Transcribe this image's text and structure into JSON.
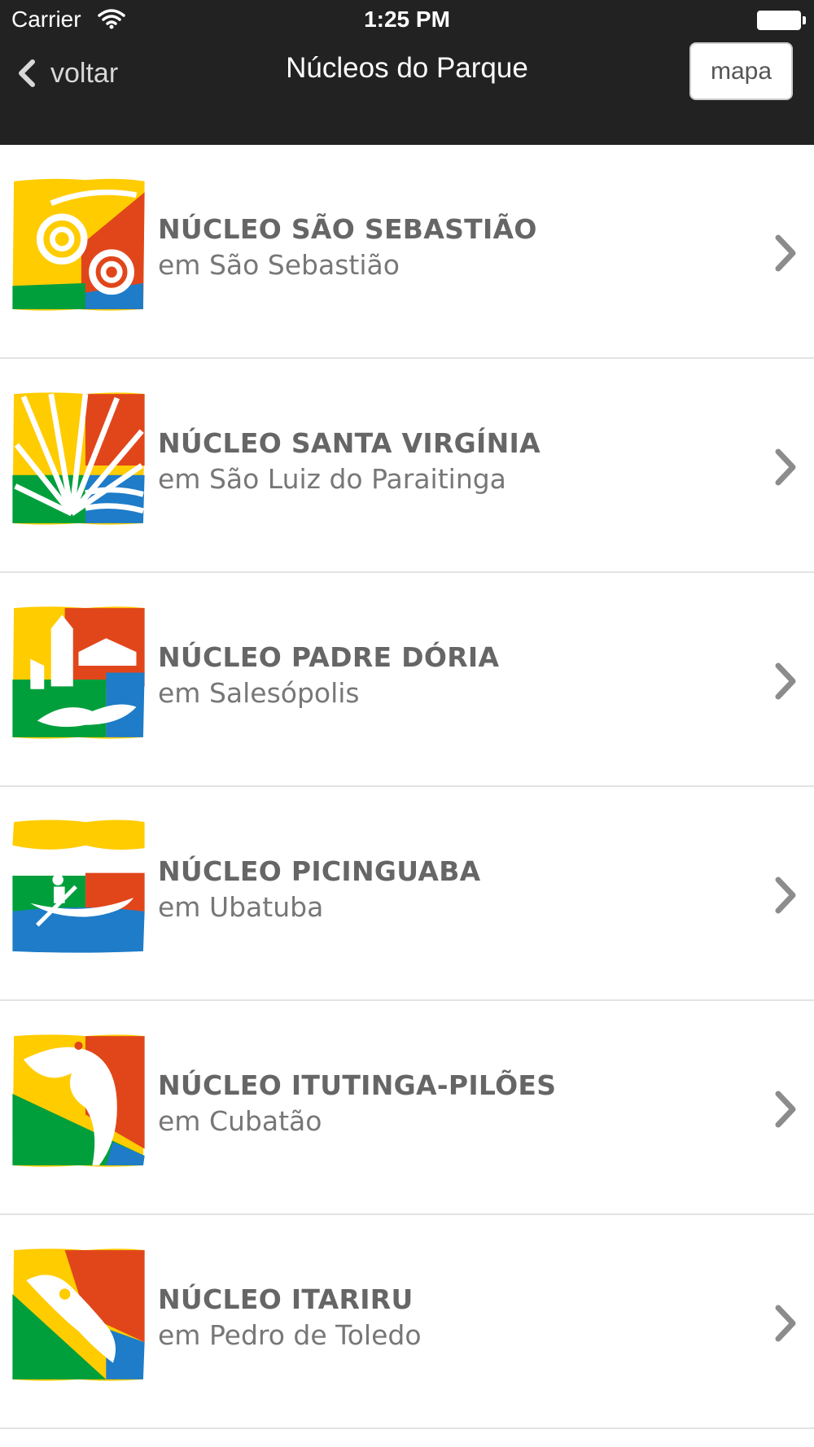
{
  "status_bar": {
    "carrier": "Carrier",
    "time": "1:25 PM"
  },
  "nav": {
    "back_label": "voltar",
    "title": "Núcleos do Parque",
    "map_button": "mapa"
  },
  "items": [
    {
      "name": "NÚCLEO SÃO SEBASTIÃO",
      "city": "em São Sebastião"
    },
    {
      "name": "NÚCLEO SANTA VIRGÍNIA",
      "city": "em São Luiz do Paraitinga"
    },
    {
      "name": "NÚCLEO PADRE DÓRIA",
      "city": "em Salesópolis"
    },
    {
      "name": "NÚCLEO PICINGUABA",
      "city": "em Ubatuba"
    },
    {
      "name": "NÚCLEO ITUTINGA-PILÕES",
      "city": "em Cubatão"
    },
    {
      "name": "NÚCLEO ITARIRU",
      "city": "em Pedro de Toledo"
    }
  ],
  "colors": {
    "yellow": "#FFCC00",
    "red": "#E1461B",
    "green": "#009F3C",
    "blue": "#1E7CC8",
    "nav_bg": "#222222"
  }
}
